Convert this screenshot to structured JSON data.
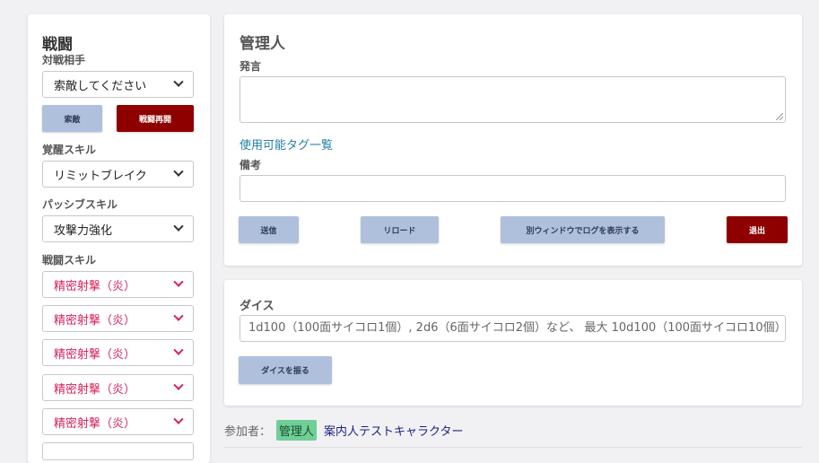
{
  "battle": {
    "title": "戦闘",
    "opponent_label": "対戦相手",
    "opponent_value": "索敵してください",
    "search_button": "索敵",
    "resume_button": "戦闘再開",
    "awakening_label": "覚醒スキル",
    "awakening_value": "リミットブレイク",
    "passive_label": "パッシブスキル",
    "passive_value": "攻撃力強化",
    "combat_label": "戦闘スキル",
    "combat_skills": [
      "精密射撃（炎）",
      "精密射撃（炎）",
      "精密射撃（炎）",
      "精密射撃（炎）",
      "精密射撃（炎）"
    ],
    "skill_color": "#d6245a"
  },
  "chat": {
    "title": "管理人",
    "speech_label": "発言",
    "speech_value": "",
    "tags_link": "使用可能タグ一覧",
    "note_label": "備考",
    "note_value": "",
    "send_button": "送信",
    "reload_button": "リロード",
    "popout_button": "別ウィンドウでログを表示する",
    "exit_button": "退出"
  },
  "dice": {
    "label": "ダイス",
    "placeholder": "1d100（100面サイコロ1個）, 2d6（6面サイコロ2個）など、 最大 10d100（100面サイコロ10個）",
    "roll_button": "ダイスを振る"
  },
  "participants": {
    "label": "参加者：",
    "admin_tag": "管理人",
    "guide_name": "案内人テストキャラクター"
  },
  "colors": {
    "button_blue": "#aec0dc",
    "button_dark_red": "#8e0000",
    "link": "#1f7fa6",
    "admin_tag": "#6fcf97"
  }
}
